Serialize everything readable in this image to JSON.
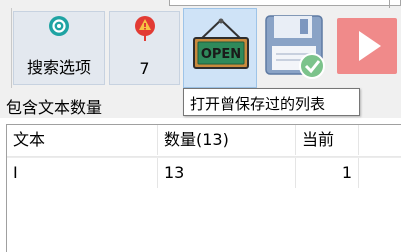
{
  "toolbar": {
    "search_options": {
      "label": "搜索选项",
      "icon": "gear-icon"
    },
    "count": {
      "value": "7",
      "icon": "warning-pin-icon"
    },
    "open_button": {
      "sign_text": "OPEN",
      "icon": "open-sign-icon"
    },
    "save_button": {
      "icon": "save-disk-icon"
    },
    "play_button": {
      "icon": "play-icon"
    }
  },
  "section": {
    "title": "包含文本数量"
  },
  "tooltip": {
    "text": "打开曾保存过的列表"
  },
  "table": {
    "columns": [
      "文本",
      "数量(13)",
      "当前",
      ""
    ],
    "rows": [
      {
        "text": "I",
        "count": "13",
        "current": "1"
      }
    ]
  },
  "colors": {
    "accent_teal": "#1fa3a3",
    "accent_red": "#e23b34",
    "open_sign_green": "#2f8a5b",
    "play_red": "#f08a8a"
  }
}
